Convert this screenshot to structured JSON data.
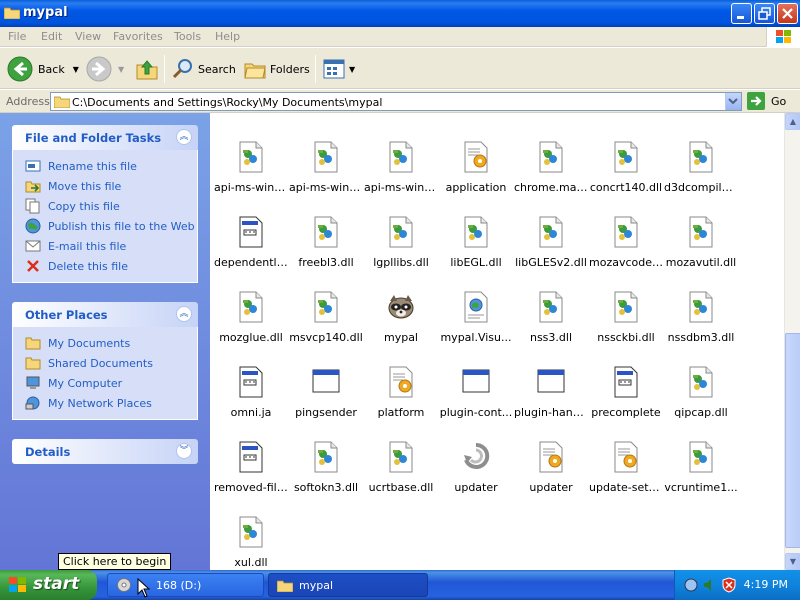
{
  "window": {
    "title": "mypal",
    "controls": [
      "minimize",
      "maximize",
      "close"
    ]
  },
  "menu": [
    "File",
    "Edit",
    "View",
    "Favorites",
    "Tools",
    "Help"
  ],
  "toolbar": {
    "back_label": "Back",
    "search_label": "Search",
    "folders_label": "Folders"
  },
  "address": {
    "label": "Address",
    "path": "C:\\Documents and Settings\\Rocky\\My Documents\\mypal",
    "go_label": "Go"
  },
  "left_panel": {
    "file_tasks": {
      "title": "File and Folder Tasks",
      "items": [
        {
          "label": "Rename this file",
          "icon": "rename-icon"
        },
        {
          "label": "Move this file",
          "icon": "move-icon"
        },
        {
          "label": "Copy this file",
          "icon": "copy-icon"
        },
        {
          "label": "Publish this file to the Web",
          "icon": "globe-icon"
        },
        {
          "label": "E-mail this file",
          "icon": "email-icon"
        },
        {
          "label": "Delete this file",
          "icon": "delete-icon"
        }
      ]
    },
    "other_places": {
      "title": "Other Places",
      "items": [
        {
          "label": "My Documents",
          "icon": "folder-icon"
        },
        {
          "label": "Shared Documents",
          "icon": "folder-icon"
        },
        {
          "label": "My Computer",
          "icon": "computer-icon"
        },
        {
          "label": "My Network Places",
          "icon": "network-icon"
        }
      ]
    },
    "details": {
      "title": "Details"
    }
  },
  "files": [
    {
      "name": "api-ms-win-...",
      "icon": "dll-icon"
    },
    {
      "name": "api-ms-win-...",
      "icon": "dll-icon"
    },
    {
      "name": "api-ms-win-...",
      "icon": "dll-icon"
    },
    {
      "name": "application",
      "icon": "config-icon"
    },
    {
      "name": "chrome.man...",
      "icon": "dll-icon"
    },
    {
      "name": "concrt140.dll",
      "icon": "dll-icon"
    },
    {
      "name": "d3dcompiler...",
      "icon": "dll-icon"
    },
    {
      "name": "dependentli...",
      "icon": "document-icon"
    },
    {
      "name": "freebl3.dll",
      "icon": "dll-icon"
    },
    {
      "name": "lgpllibs.dll",
      "icon": "dll-icon"
    },
    {
      "name": "libEGL.dll",
      "icon": "dll-icon"
    },
    {
      "name": "libGLESv2.dll",
      "icon": "dll-icon"
    },
    {
      "name": "mozavcodec...",
      "icon": "dll-icon"
    },
    {
      "name": "mozavutil.dll",
      "icon": "dll-icon"
    },
    {
      "name": "mozglue.dll",
      "icon": "dll-icon"
    },
    {
      "name": "msvcp140.dll",
      "icon": "dll-icon"
    },
    {
      "name": "mypal",
      "icon": "raccoon-icon"
    },
    {
      "name": "mypal.Visu...",
      "icon": "manifest-icon"
    },
    {
      "name": "nss3.dll",
      "icon": "dll-icon"
    },
    {
      "name": "nssckbi.dll",
      "icon": "dll-icon"
    },
    {
      "name": "nssdbm3.dll",
      "icon": "dll-icon"
    },
    {
      "name": "omni.ja",
      "icon": "document-icon"
    },
    {
      "name": "pingsender",
      "icon": "window-icon"
    },
    {
      "name": "platform",
      "icon": "config-icon"
    },
    {
      "name": "plugin-cont...",
      "icon": "window-icon"
    },
    {
      "name": "plugin-hang-ui",
      "icon": "window-icon"
    },
    {
      "name": "precomplete",
      "icon": "document-icon"
    },
    {
      "name": "qipcap.dll",
      "icon": "dll-icon"
    },
    {
      "name": "removed-files",
      "icon": "document-icon"
    },
    {
      "name": "softokn3.dll",
      "icon": "dll-icon"
    },
    {
      "name": "ucrtbase.dll",
      "icon": "dll-icon"
    },
    {
      "name": "updater",
      "icon": "recycle-icon"
    },
    {
      "name": "updater",
      "icon": "config-icon"
    },
    {
      "name": "update-setti...",
      "icon": "config-icon"
    },
    {
      "name": "vcruntime1...",
      "icon": "dll-icon"
    },
    {
      "name": "xul.dll",
      "icon": "dll-icon"
    }
  ],
  "taskbar": {
    "start_label": "start",
    "tooltip": "Click here to begin",
    "tabs": [
      {
        "label": "168 (D:)",
        "icon": "cd-drive-icon"
      },
      {
        "label": "mypal",
        "icon": "folder-icon"
      }
    ],
    "clock": "4:19 PM"
  }
}
